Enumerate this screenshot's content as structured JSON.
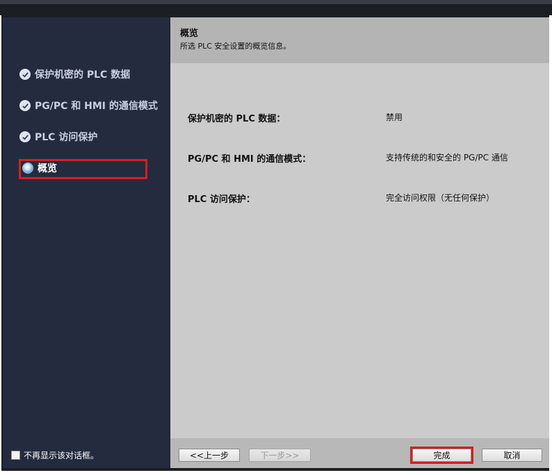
{
  "sidebar": {
    "steps": [
      {
        "label": "保护机密的 PLC 数据",
        "state": "done"
      },
      {
        "label": "PG/PC 和 HMI 的通信模式",
        "state": "done"
      },
      {
        "label": "PLC 访问保护",
        "state": "done"
      },
      {
        "label": "概览",
        "state": "active"
      }
    ],
    "dont_show_label": "不再显示该对话框。"
  },
  "header": {
    "title": "概览",
    "subtitle": "所选 PLC 安全设置的概览信息。"
  },
  "summary": [
    {
      "label": "保护机密的 PLC 数据：",
      "value": "禁用"
    },
    {
      "label": "PG/PC 和 HMI 的通信模式：",
      "value": "支持传统的和安全的 PG/PC 通信"
    },
    {
      "label": "PLC 访问保护：",
      "value": "完全访问权限（无任何保护）"
    }
  ],
  "buttons": {
    "back": "<<上一步",
    "next": "下一步>>",
    "finish": "完成",
    "cancel": "取消"
  },
  "colors": {
    "sidebar_bg": "#252b3e",
    "content_bg": "#cbcbcb",
    "header_bg": "#b4b4b4",
    "highlight": "#d42020"
  }
}
